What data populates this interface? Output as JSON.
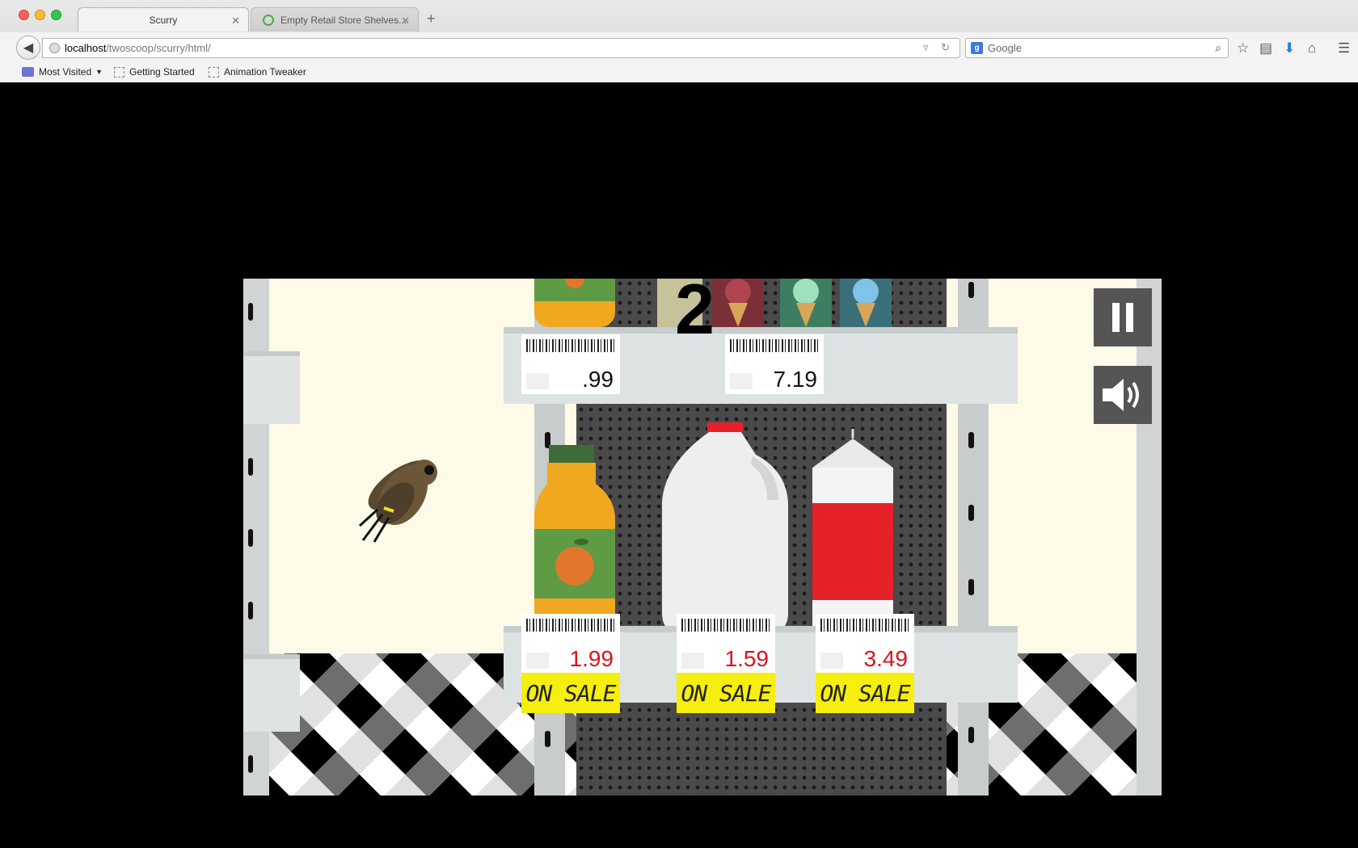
{
  "browser": {
    "tabs": [
      {
        "label": "Scurry",
        "active": true
      },
      {
        "label": "Empty Retail Store Shelves...",
        "active": false
      }
    ],
    "new_tab_label": "+",
    "url_host": "localhost",
    "url_path": "/twoscoop/scurry/html/",
    "search_placeholder": "Google",
    "search_engine_icon": "g",
    "bookmarks": [
      "Most Visited",
      "Getting Started",
      "Animation Tweaker"
    ]
  },
  "game": {
    "score": "2",
    "top_shelf_prices": [
      ".99",
      "7.19"
    ],
    "bottom_shelf_prices": [
      "1.99",
      "1.59",
      "3.49"
    ],
    "sale_label": "ON SALE",
    "products": [
      "orange-juice-bottle",
      "milk-gallon",
      "milk-carton"
    ],
    "colors": {
      "background": "#fdfbe8",
      "sale_tag": "#f5ee0e",
      "sale_price": "#d8141b",
      "control_button": "#555555"
    },
    "controls": [
      "pause-icon",
      "speaker-icon"
    ]
  }
}
